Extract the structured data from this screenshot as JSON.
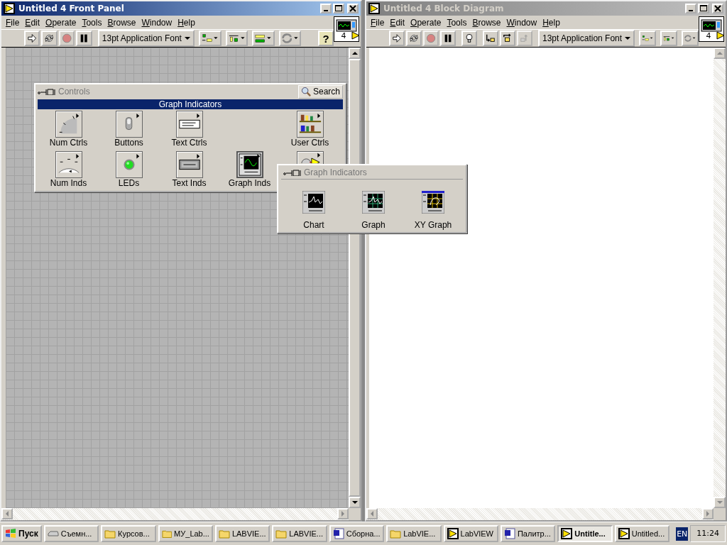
{
  "windows": [
    {
      "kind": "front_panel",
      "title": "Untitled 4 Front Panel",
      "active": true,
      "menu": [
        "File",
        "Edit",
        "Operate",
        "Tools",
        "Browse",
        "Window",
        "Help"
      ],
      "font_selector": "13pt Application Font",
      "help_button": "?",
      "connector_pane": "4"
    },
    {
      "kind": "block_diagram",
      "title": "Untitled 4 Block Diagram",
      "active": false,
      "menu": [
        "File",
        "Edit",
        "Operate",
        "Tools",
        "Browse",
        "Window",
        "Help"
      ],
      "font_selector": "13pt Application Font",
      "connector_pane": "4"
    }
  ],
  "controls_palette": {
    "title": "Controls",
    "search": "Search",
    "category": "Graph Indicators",
    "rows": [
      [
        {
          "kind": "knob",
          "label": "Num Ctrls",
          "selected": false
        },
        {
          "kind": "toggle",
          "label": "Buttons",
          "selected": false
        },
        {
          "kind": "text",
          "label": "Text Ctrls",
          "selected": false
        },
        {
          "kind": "blank"
        },
        {
          "kind": "shelf",
          "label": "User Ctrls",
          "selected": false
        }
      ],
      [
        {
          "kind": "gauge",
          "label": "Num Inds",
          "selected": false
        },
        {
          "kind": "led",
          "label": "LEDs",
          "selected": false
        },
        {
          "kind": "textind",
          "label": "Text Inds",
          "selected": false
        },
        {
          "kind": "graph",
          "label": "Graph Inds",
          "selected": true
        },
        {
          "kind": "express",
          "selected": false
        }
      ]
    ]
  },
  "graph_palette": {
    "title": "Graph Indicators",
    "items": [
      {
        "kind": "chart",
        "label": "Chart"
      },
      {
        "kind": "grid",
        "label": "Graph"
      },
      {
        "kind": "xy",
        "label": "XY Graph"
      }
    ]
  },
  "taskbar": {
    "start": "Пуск",
    "tasks": [
      {
        "kind": "drive",
        "label": "Съемн...",
        "selected": false
      },
      {
        "kind": "folder",
        "label": "Курсов...",
        "selected": false
      },
      {
        "kind": "folder",
        "label": "МУ_Lab...",
        "selected": false
      },
      {
        "kind": "folder",
        "label": "LABVIE...",
        "selected": false
      },
      {
        "kind": "folder",
        "label": "LABVIE...",
        "selected": false
      },
      {
        "kind": "word",
        "label": "Сборна...",
        "selected": false
      },
      {
        "kind": "openfolder",
        "label": "LabVIE...",
        "selected": false
      },
      {
        "kind": "labview",
        "label": "LabVIEW",
        "selected": false
      },
      {
        "kind": "word",
        "label": "Палитр...",
        "selected": false
      },
      {
        "kind": "labview",
        "label": "Untitle...",
        "selected": true
      },
      {
        "kind": "labview",
        "label": "Untitled...",
        "selected": false
      }
    ],
    "language": "EN",
    "clock": "11:24"
  }
}
